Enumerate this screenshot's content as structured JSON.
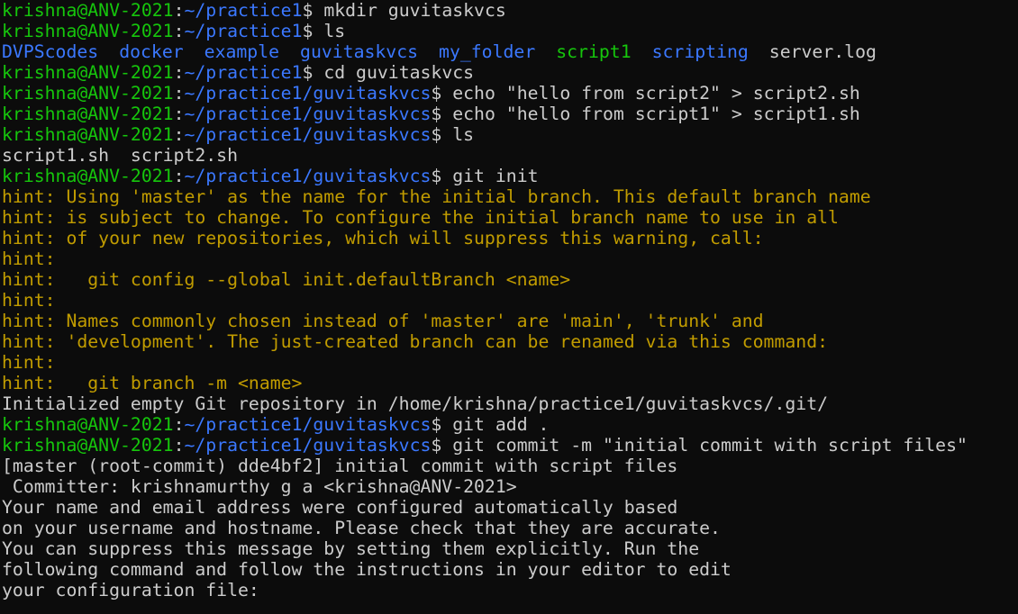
{
  "colors": {
    "background": "#0c0c0c",
    "foreground": "#cccccc",
    "prompt_user": "#16c60c",
    "prompt_path": "#3b78ff",
    "hint": "#c19c00",
    "directory": "#3b78ff",
    "executable": "#16c60c"
  },
  "lines": [
    {
      "type": "prompt",
      "user": "krishna@ANV-2021",
      "colon": ":",
      "path": "~/practice1",
      "sigil": "$ ",
      "command": "mkdir guvitaskvcs"
    },
    {
      "type": "prompt",
      "user": "krishna@ANV-2021",
      "colon": ":",
      "path": "~/practice1",
      "sigil": "$ ",
      "command": "ls"
    },
    {
      "type": "ls",
      "items": [
        {
          "name": "DVPScodes",
          "kind": "dir"
        },
        {
          "name": "docker",
          "kind": "dir"
        },
        {
          "name": "example",
          "kind": "dir"
        },
        {
          "name": "guvitaskvcs",
          "kind": "dir"
        },
        {
          "name": "my_folder",
          "kind": "dir"
        },
        {
          "name": "script1",
          "kind": "exec"
        },
        {
          "name": "scripting",
          "kind": "dir"
        },
        {
          "name": "server.log",
          "kind": "file"
        }
      ]
    },
    {
      "type": "prompt",
      "user": "krishna@ANV-2021",
      "colon": ":",
      "path": "~/practice1",
      "sigil": "$ ",
      "command": "cd guvitaskvcs"
    },
    {
      "type": "prompt",
      "user": "krishna@ANV-2021",
      "colon": ":",
      "path": "~/practice1/guvitaskvcs",
      "sigil": "$ ",
      "command": "echo \"hello from script2\" > script2.sh"
    },
    {
      "type": "prompt",
      "user": "krishna@ANV-2021",
      "colon": ":",
      "path": "~/practice1/guvitaskvcs",
      "sigil": "$ ",
      "command": "echo \"hello from script1\" > script1.sh"
    },
    {
      "type": "prompt",
      "user": "krishna@ANV-2021",
      "colon": ":",
      "path": "~/practice1/guvitaskvcs",
      "sigil": "$ ",
      "command": "ls"
    },
    {
      "type": "output",
      "text": "script1.sh  script2.sh"
    },
    {
      "type": "prompt",
      "user": "krishna@ANV-2021",
      "colon": ":",
      "path": "~/practice1/guvitaskvcs",
      "sigil": "$ ",
      "command": "git init"
    },
    {
      "type": "hint",
      "text": "hint: Using 'master' as the name for the initial branch. This default branch name"
    },
    {
      "type": "hint",
      "text": "hint: is subject to change. To configure the initial branch name to use in all"
    },
    {
      "type": "hint",
      "text": "hint: of your new repositories, which will suppress this warning, call:"
    },
    {
      "type": "hint",
      "text": "hint:"
    },
    {
      "type": "hint",
      "text": "hint:   git config --global init.defaultBranch <name>"
    },
    {
      "type": "hint",
      "text": "hint:"
    },
    {
      "type": "hint",
      "text": "hint: Names commonly chosen instead of 'master' are 'main', 'trunk' and"
    },
    {
      "type": "hint",
      "text": "hint: 'development'. The just-created branch can be renamed via this command:"
    },
    {
      "type": "hint",
      "text": "hint:"
    },
    {
      "type": "hint",
      "text": "hint:   git branch -m <name>"
    },
    {
      "type": "output",
      "text": "Initialized empty Git repository in /home/krishna/practice1/guvitaskvcs/.git/"
    },
    {
      "type": "prompt",
      "user": "krishna@ANV-2021",
      "colon": ":",
      "path": "~/practice1/guvitaskvcs",
      "sigil": "$ ",
      "command": "git add ."
    },
    {
      "type": "prompt",
      "user": "krishna@ANV-2021",
      "colon": ":",
      "path": "~/practice1/guvitaskvcs",
      "sigil": "$ ",
      "command": "git commit -m \"initial commit with script files\""
    },
    {
      "type": "output",
      "text": "[master (root-commit) dde4bf2] initial commit with script files"
    },
    {
      "type": "output",
      "text": " Committer: krishnamurthy g a <krishna@ANV-2021>"
    },
    {
      "type": "output",
      "text": "Your name and email address were configured automatically based"
    },
    {
      "type": "output",
      "text": "on your username and hostname. Please check that they are accurate."
    },
    {
      "type": "output",
      "text": "You can suppress this message by setting them explicitly. Run the"
    },
    {
      "type": "output",
      "text": "following command and follow the instructions in your editor to edit"
    },
    {
      "type": "output",
      "text": "your configuration file:"
    }
  ]
}
